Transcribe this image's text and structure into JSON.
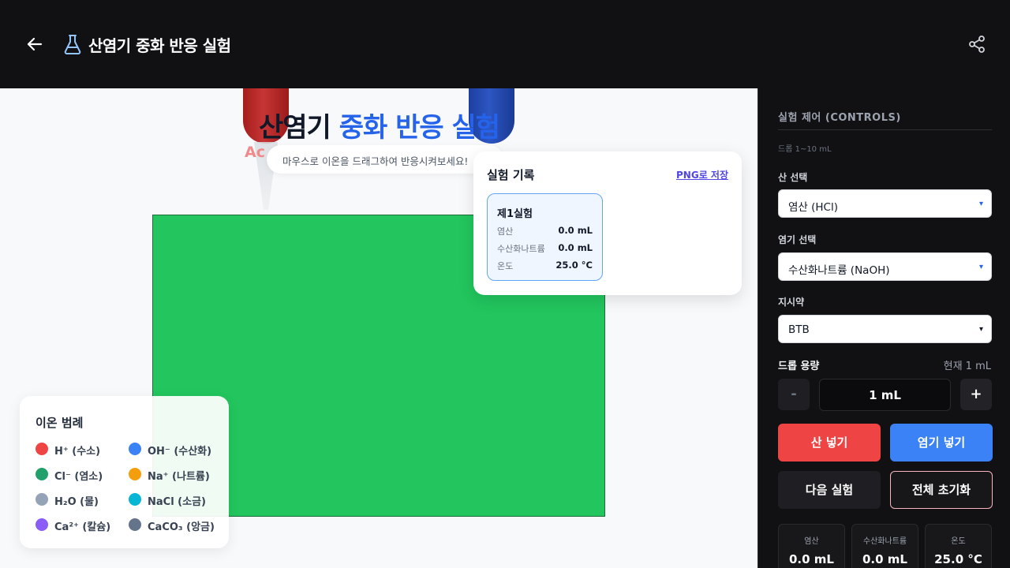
{
  "header": {
    "title": "산염기 중화 반응 실험",
    "back_icon": "arrow-left-icon",
    "title_icon": "flask-icon",
    "share_icon": "share-icon",
    "background": "#111113"
  },
  "stage": {
    "title_dark": "산염기",
    "title_blue": "중화 반응 실험",
    "hint": "마우스로 이온을 드래그하여 반응시켜보세요!",
    "acid_dropper_label": "Ac",
    "solution_color": "#22c55e"
  },
  "records": {
    "title": "실험 기록",
    "save_label": "PNG로 저장",
    "cards": [
      {
        "title": "제1실험",
        "rows": [
          {
            "label": "염산",
            "value": "0.0 mL"
          },
          {
            "label": "수산화나트륨",
            "value": "0.0 mL"
          },
          {
            "label": "온도",
            "value": "25.0 °C"
          }
        ]
      }
    ]
  },
  "legend": {
    "title": "이온 범례",
    "items": [
      {
        "label": "H⁺ (수소)",
        "color": "#ef4444"
      },
      {
        "label": "OH⁻ (수산화)",
        "color": "#3b82f6"
      },
      {
        "label": "Cl⁻ (염소)",
        "color": "#22a06b"
      },
      {
        "label": "Na⁺ (나트륨)",
        "color": "#f59e0b"
      },
      {
        "label": "H₂O (물)",
        "color": "#94a3b8"
      },
      {
        "label": "NaCl (소금)",
        "color": "#06b6d4"
      },
      {
        "label": "Ca²⁺ (칼슘)",
        "color": "#8b5cf6"
      },
      {
        "label": "CaCO₃ (앙금)",
        "color": "#64748b"
      }
    ]
  },
  "controls": {
    "heading": "실험 제어 (CONTROLS)",
    "hint": "드롭 1~10 mL",
    "acid_label": "산 선택",
    "acid_value": "염산 (HCl)",
    "base_label": "염기 선택",
    "base_value": "수산화나트륨 (NaOH)",
    "indicator_label": "지시약",
    "indicator_value": "BTB",
    "dose_label": "드롭 용량",
    "dose_current": "현재 1 mL",
    "dose_minus": "-",
    "dose_value": "1 mL",
    "dose_plus": "+",
    "add_acid": "산 넣기",
    "add_base": "염기 넣기",
    "next_experiment": "다음 실험",
    "reset_all": "전체 초기화",
    "stats": [
      {
        "label": "염산",
        "value": "0.0 mL"
      },
      {
        "label": "수산화나트륨",
        "value": "0.0 mL"
      },
      {
        "label": "온도",
        "value": "25.0 °C"
      }
    ]
  }
}
